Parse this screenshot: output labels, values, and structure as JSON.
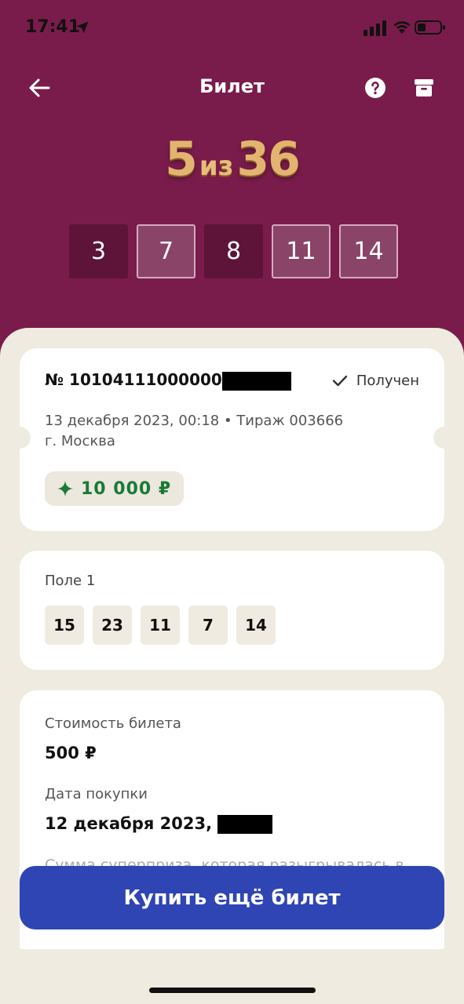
{
  "status_bar": {
    "time": "17:41"
  },
  "header": {
    "title": "Билет"
  },
  "logo": {
    "first": "5",
    "middle": "из",
    "last": "36"
  },
  "draw": {
    "numbers": [
      {
        "value": "3",
        "style": "dark"
      },
      {
        "value": "7",
        "style": "light"
      },
      {
        "value": "8",
        "style": "dark"
      },
      {
        "value": "11",
        "style": "light"
      },
      {
        "value": "14",
        "style": "light"
      }
    ]
  },
  "ticket": {
    "number": "№ 10104111000000",
    "status": "Получен",
    "date_line": "13 декабря 2023, 00:18 • Тираж 003666",
    "city": "г. Москва",
    "win_amount": "10 000 ₽"
  },
  "field": {
    "label": "Поле 1",
    "numbers": [
      "15",
      "23",
      "11",
      "7",
      "14"
    ]
  },
  "info": {
    "price_label": "Стоимость билета",
    "price_value": "500 ₽",
    "purchase_label": "Дата покупки",
    "purchase_value": "12 декабря 2023,",
    "faded_text": "Сумма суперприза, которая разыгрывалась в"
  },
  "buy_button": {
    "label": "Купить ещё билет"
  },
  "colors": {
    "background": "#7a1c4b",
    "sheet": "#efebe0",
    "accent_button": "#2f45b4",
    "win_green": "#1a7a37",
    "logo_gold": "#e3b46f"
  }
}
